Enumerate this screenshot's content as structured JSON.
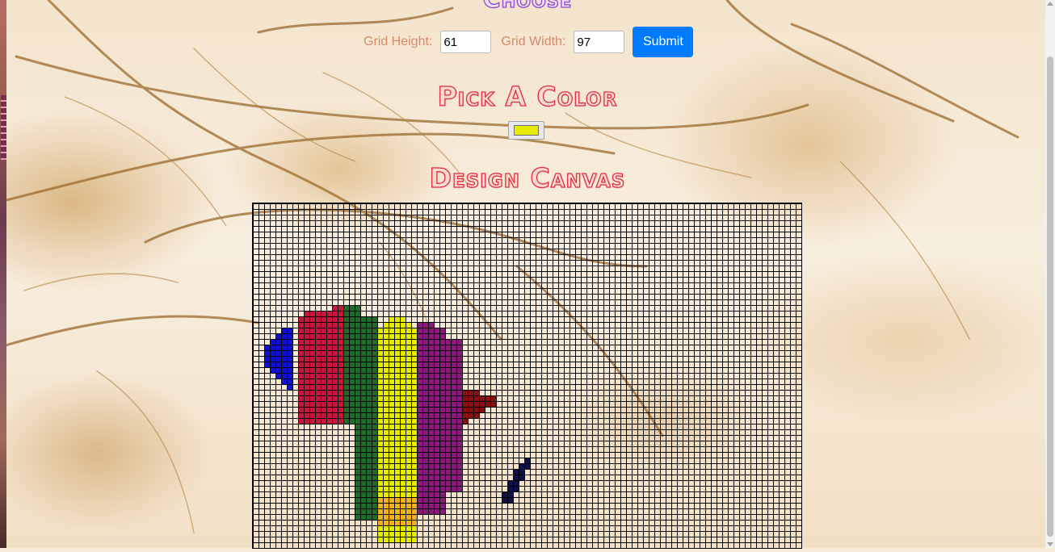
{
  "headings": {
    "choose": "Choose",
    "pick_color": "Pick A Color",
    "design_canvas": "Design Canvas"
  },
  "size_form": {
    "height_label": "Grid Height:",
    "height_value": "61",
    "width_label": "Grid Width:",
    "width_value": "97",
    "submit_label": "Submit"
  },
  "color_picker": {
    "value": "#e6ec00"
  },
  "canvas": {
    "rows": 61,
    "cols": 97,
    "line_color": "#000000",
    "painted_cells": {
      "#1010d0": [
        [
          22,
          5
        ],
        [
          22,
          6
        ],
        [
          23,
          4
        ],
        [
          23,
          5
        ],
        [
          23,
          6
        ],
        [
          24,
          3
        ],
        [
          24,
          4
        ],
        [
          24,
          5
        ],
        [
          24,
          6
        ],
        [
          25,
          2
        ],
        [
          25,
          3
        ],
        [
          25,
          4
        ],
        [
          25,
          5
        ],
        [
          25,
          6
        ],
        [
          26,
          2
        ],
        [
          26,
          3
        ],
        [
          26,
          4
        ],
        [
          26,
          5
        ],
        [
          26,
          6
        ],
        [
          27,
          2
        ],
        [
          27,
          3
        ],
        [
          27,
          4
        ],
        [
          27,
          5
        ],
        [
          27,
          6
        ],
        [
          28,
          2
        ],
        [
          28,
          3
        ],
        [
          28,
          4
        ],
        [
          28,
          5
        ],
        [
          28,
          6
        ],
        [
          29,
          3
        ],
        [
          29,
          4
        ],
        [
          29,
          5
        ],
        [
          29,
          6
        ],
        [
          30,
          4
        ],
        [
          30,
          5
        ],
        [
          30,
          6
        ],
        [
          31,
          5
        ],
        [
          31,
          6
        ],
        [
          32,
          6
        ]
      ],
      "#c8153c": [
        [
          19,
          9
        ],
        [
          19,
          10
        ],
        [
          19,
          11
        ],
        [
          19,
          12
        ],
        [
          19,
          13
        ],
        [
          19,
          14
        ],
        [
          19,
          15
        ],
        [
          18,
          14
        ],
        [
          18,
          15
        ]
      ],
      "#1f6b2a": [
        [
          18,
          16
        ],
        [
          18,
          17
        ],
        [
          18,
          18
        ],
        [
          19,
          16
        ],
        [
          19,
          17
        ],
        [
          19,
          18
        ]
      ],
      "#e6ec00": [
        [
          20,
          24
        ],
        [
          20,
          25
        ],
        [
          20,
          26
        ],
        [
          21,
          23
        ],
        [
          21,
          24
        ],
        [
          21,
          25
        ],
        [
          21,
          26
        ],
        [
          21,
          27
        ]
      ],
      "#8a1a7a": [
        [
          21,
          29
        ],
        [
          21,
          30
        ],
        [
          21,
          31
        ]
      ],
      "#8a1010": [
        [
          33,
          37
        ],
        [
          33,
          38
        ],
        [
          33,
          39
        ],
        [
          34,
          37
        ],
        [
          34,
          38
        ],
        [
          34,
          39
        ],
        [
          34,
          40
        ],
        [
          34,
          41
        ],
        [
          34,
          42
        ],
        [
          35,
          37
        ],
        [
          35,
          38
        ],
        [
          35,
          39
        ],
        [
          35,
          40
        ],
        [
          35,
          41
        ],
        [
          35,
          42
        ],
        [
          36,
          37
        ],
        [
          36,
          38
        ],
        [
          36,
          39
        ],
        [
          36,
          40
        ],
        [
          37,
          37
        ],
        [
          37,
          38
        ],
        [
          37,
          39
        ],
        [
          38,
          37
        ]
      ],
      "#0f104a": [
        [
          45,
          48
        ],
        [
          46,
          47
        ],
        [
          46,
          48
        ],
        [
          47,
          46
        ],
        [
          47,
          47
        ],
        [
          48,
          46
        ],
        [
          48,
          47
        ],
        [
          49,
          45
        ],
        [
          49,
          46
        ],
        [
          50,
          45
        ],
        [
          50,
          46
        ],
        [
          51,
          44
        ],
        [
          51,
          45
        ],
        [
          52,
          44
        ],
        [
          52,
          45
        ]
      ]
    },
    "painted_regions": [
      {
        "color": "#c8153c",
        "rows": [
          20,
          38
        ],
        "cols": [
          8,
          15
        ]
      },
      {
        "color": "#1f6b2a",
        "rows": [
          20,
          38
        ],
        "cols": [
          16,
          21
        ]
      },
      {
        "color": "#1f6b2a",
        "rows": [
          39,
          55
        ],
        "cols": [
          18,
          21
        ]
      },
      {
        "color": "#e6ec00",
        "rows": [
          22,
          59
        ],
        "cols": [
          22,
          28
        ]
      },
      {
        "color": "#f0b020",
        "rows": [
          52,
          56
        ],
        "cols": [
          22,
          28
        ]
      },
      {
        "color": "#8a1a7a",
        "rows": [
          22,
          54
        ],
        "cols": [
          29,
          33
        ]
      },
      {
        "color": "#8a1a7a",
        "rows": [
          24,
          50
        ],
        "cols": [
          34,
          36
        ]
      }
    ]
  }
}
